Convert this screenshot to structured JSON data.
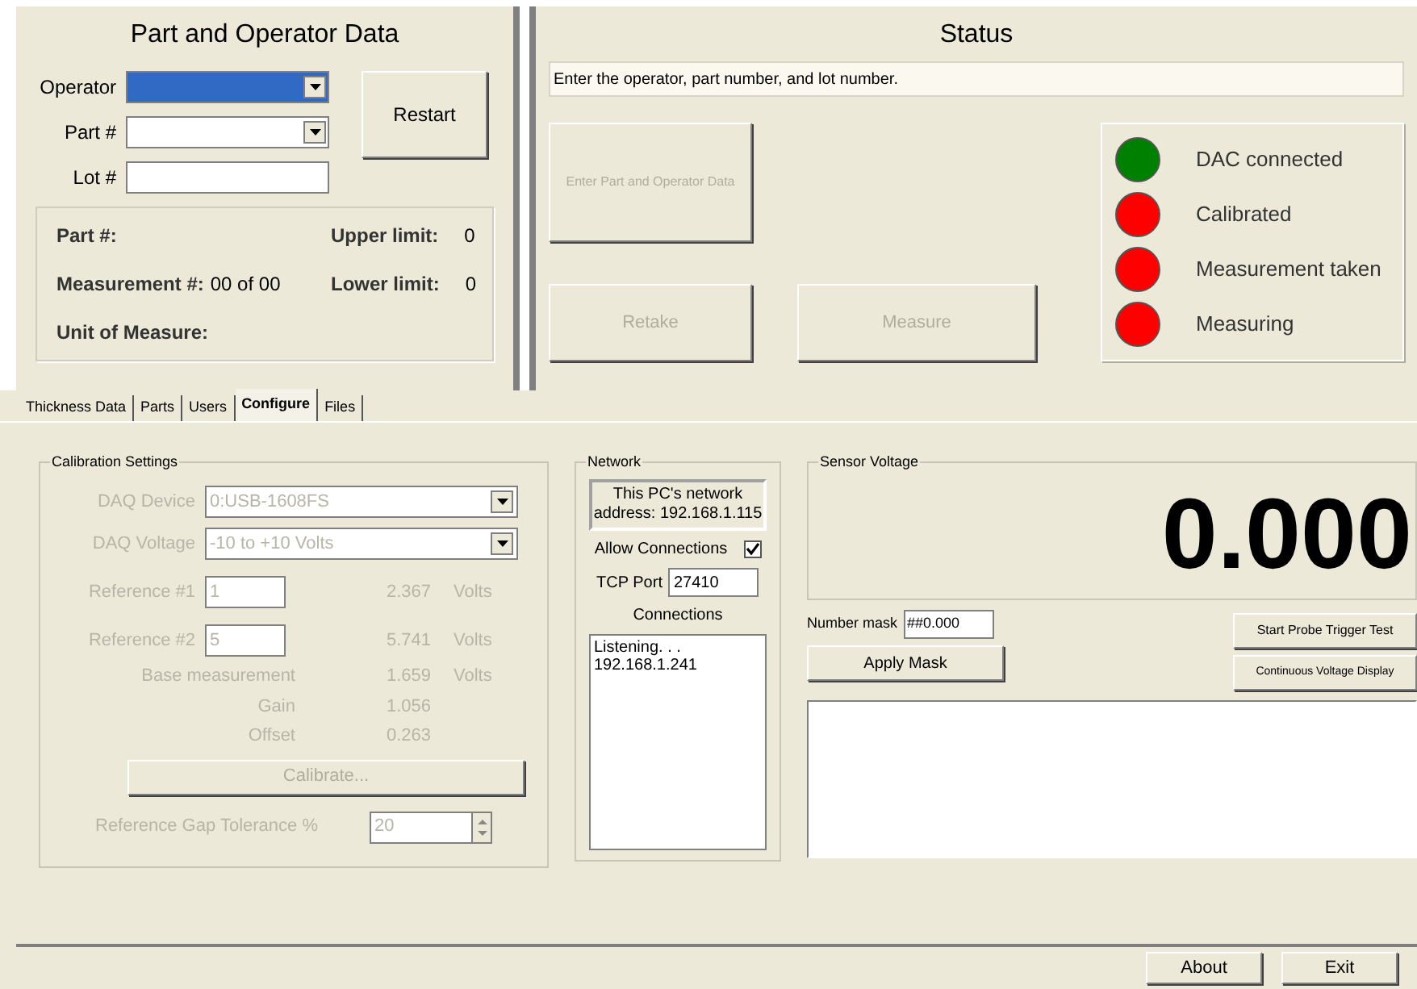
{
  "part_panel": {
    "title": "Part and Operator Data",
    "fields": [
      {
        "label": "Operator",
        "kind": "dropdown",
        "selected": true
      },
      {
        "label": "Part #",
        "kind": "dropdown",
        "selected": false
      },
      {
        "label": "Lot #",
        "kind": "text",
        "selected": false
      }
    ],
    "restart": "Restart",
    "info": [
      {
        "label": "Part #:"
      },
      {
        "label": "Upper limit:",
        "value": "0"
      },
      {
        "label": "Measurement #:",
        "value": "00 of 00"
      },
      {
        "label": "Lower limit:",
        "value": "0"
      },
      {
        "label": "Unit of Measure:"
      }
    ]
  },
  "status": {
    "title": "Status",
    "message": "Enter the operator, part number, and lot number.",
    "enter_button": {
      "label": "Enter Part and Operator Data",
      "disabled": true
    },
    "retake": {
      "label": "Retake",
      "disabled": true
    },
    "measure": {
      "label": "Measure",
      "disabled": true
    },
    "indicators": [
      {
        "label": "DAC connected",
        "color": "#008000"
      },
      {
        "label": "Calibrated",
        "color": "#ff0000"
      },
      {
        "label": "Measurement taken",
        "color": "#ff0000"
      },
      {
        "label": "Measuring",
        "color": "#ff0000"
      }
    ]
  },
  "tabs": [
    {
      "label": "Thickness Data",
      "selected": false
    },
    {
      "label": "Parts",
      "selected": false
    },
    {
      "label": "Users",
      "selected": false
    },
    {
      "label": "Configure",
      "selected": true
    },
    {
      "label": "Files",
      "selected": false
    }
  ],
  "calibration": {
    "title": "Calibration Settings",
    "disabled": true,
    "device_label": "DAQ Device",
    "device": "0:USB-1608FS",
    "voltage_label": "DAQ Voltage",
    "voltage": "-10 to +10 Volts",
    "refs": [
      {
        "label": "Reference #1",
        "value": "1",
        "reading": "2.367",
        "unit": "Volts"
      },
      {
        "label": "Reference #2",
        "value": "5",
        "reading": "5.741",
        "unit": "Volts"
      }
    ],
    "results": [
      {
        "label": "Base measurement",
        "value": "1.659",
        "unit": "Volts"
      },
      {
        "label": "Gain",
        "value": "1.056"
      },
      {
        "label": "Offset",
        "value": "0.263"
      }
    ],
    "calibrate": "Calibrate...",
    "tolerance_label": "Reference Gap Tolerance %",
    "tolerance": "20"
  },
  "network": {
    "title": "Network",
    "address": "This PC's network address: 192.168.1.115",
    "allow_label": "Allow Connections",
    "allow_checked": true,
    "port_label": "TCP Port",
    "port": "27410",
    "connections_label": "Connections",
    "connections": [
      "Listening. . .",
      "192.168.1.241"
    ]
  },
  "sensor": {
    "title": "Sensor Voltage",
    "reading": "0.000",
    "mask_label": "Number mask",
    "mask": "##0.000",
    "apply": "Apply Mask",
    "probe": "Start Probe Trigger Test",
    "continuous": "Continuous Voltage Display"
  },
  "footer": [
    "About",
    "Exit"
  ]
}
